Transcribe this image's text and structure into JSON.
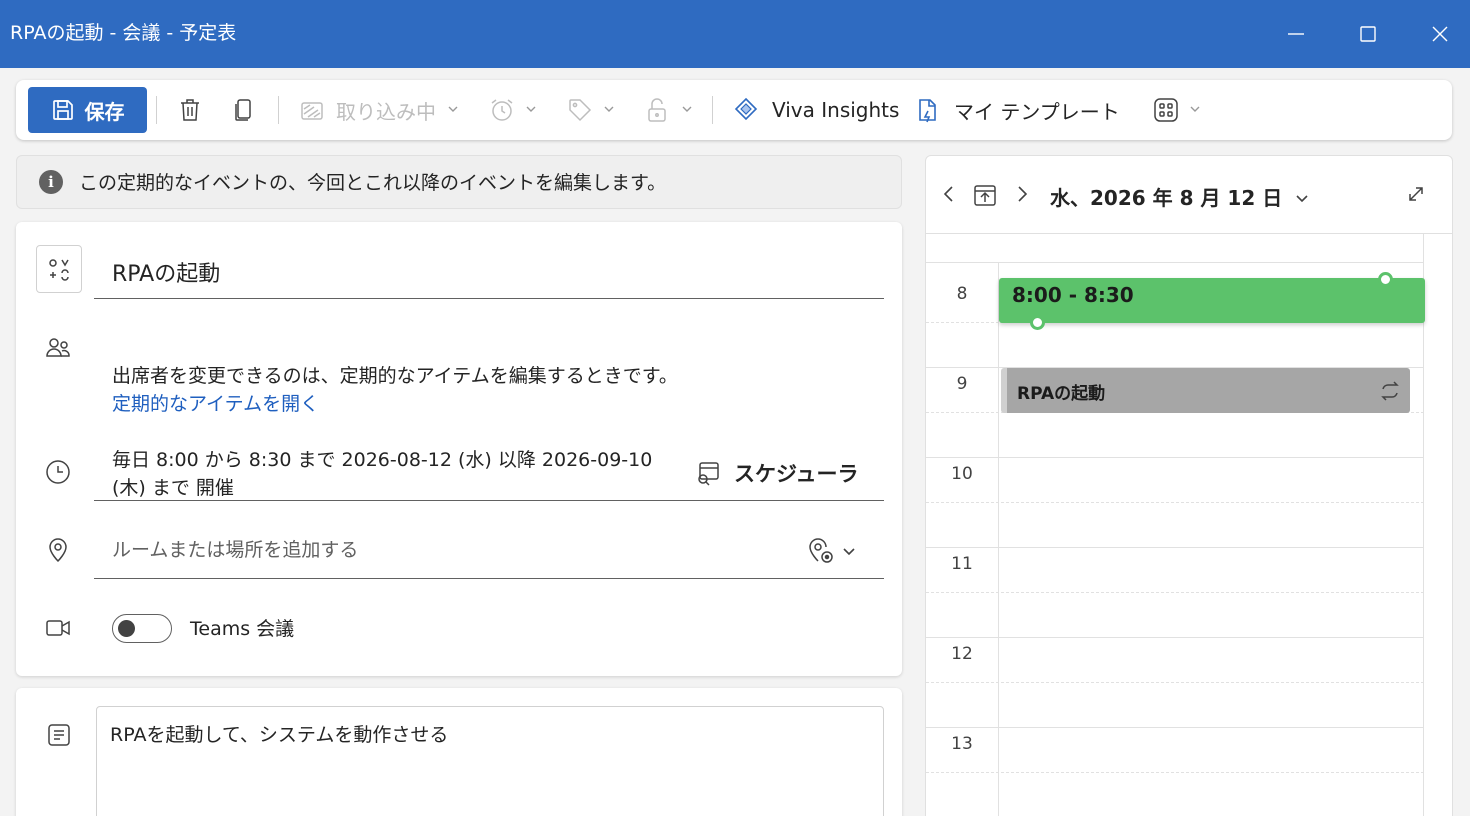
{
  "window": {
    "title": "RPAの起動 - 会議 - 予定表"
  },
  "ribbon": {
    "save_label": "保存",
    "busy_status_label": "取り込み中",
    "viva_label": "Viva Insights",
    "templates_label": "マイ テンプレート"
  },
  "info_bar": {
    "text": "この定期的なイベントの、今回とこれ以降のイベントを編集します。"
  },
  "form": {
    "title_value": "RPAの起動",
    "attendees_notice": "出席者を変更できるのは、定期的なアイテムを編集するときです。",
    "attendees_link": "定期的なアイテムを開く",
    "recurrence_line1": "毎日 8:00 から 8:30 まで 2026-08-12 (水) 以降 2026-09-10",
    "recurrence_line2": "(木) まで 開催",
    "scheduler_label": "スケジューラ",
    "location_placeholder": "ルームまたは場所を追加する",
    "teams_label": "Teams 会議",
    "teams_enabled": false,
    "description": "RPAを起動して、システムを動作させる"
  },
  "calendar": {
    "date_label": "水、2026 年 8 月 12 日",
    "hours": [
      "8",
      "9",
      "10",
      "11",
      "12",
      "13"
    ],
    "events": [
      {
        "label": "8:00 - 8:30",
        "color": "#5cc26b",
        "state": "editing"
      },
      {
        "label": "RPAの起動",
        "color": "#a6a6a6",
        "recurring": true
      }
    ]
  },
  "colors": {
    "title_bar": "#2f6bc1",
    "accent": "#2f6bc1",
    "link": "#1f5fbf",
    "event_green": "#5cc26b",
    "event_gray": "#a6a6a6"
  }
}
